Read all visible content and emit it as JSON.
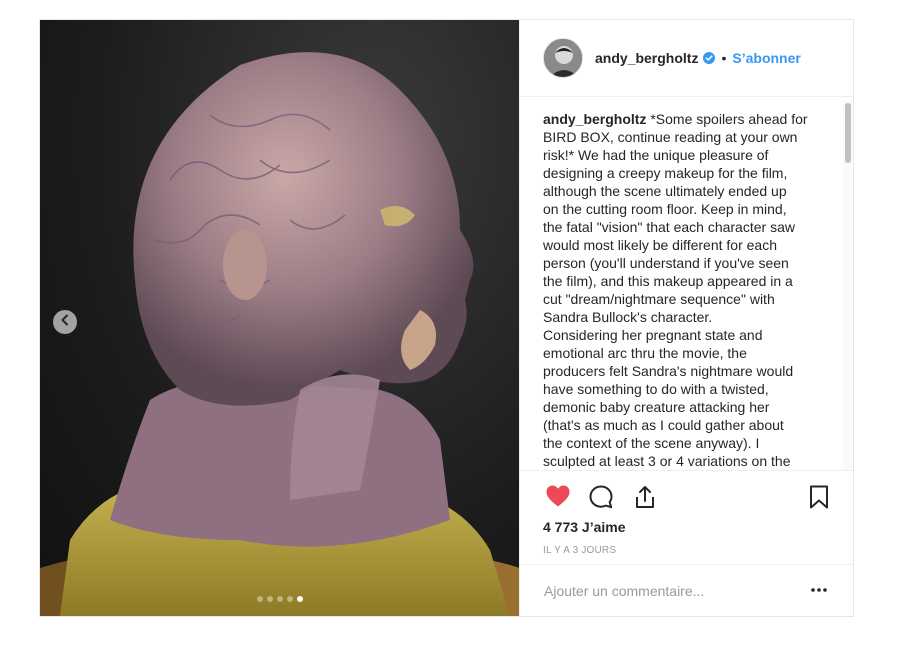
{
  "post": {
    "username": "andy_bergholtz",
    "separator": "•",
    "follow_label": "S’abonner",
    "caption_username": "andy_bergholtz",
    "caption_text": " *Some spoilers ahead for\nBIRD BOX, continue reading at your own\nrisk!* We had the unique pleasure of\ndesigning a creepy makeup for the film,\nalthough the scene ultimately ended up\non the cutting room floor. Keep in mind,\nthe fatal \"vision\" that each character saw\nwould most likely be different for each\nperson (you'll understand if you've seen\nthe film), and this makeup appeared in a\ncut \"dream/nightmare sequence\" with\nSandra Bullock's character.\nConsidering her pregnant state and\nemotional arc thru the movie, the\nproducers felt Sandra's nightmare would\nhave something to do with a twisted,\ndemonic baby creature attacking her\n(that's as much as I could gather about\nthe context of the scene anyway). I\nsculpted at least 3 or 4 variations on the",
    "likes": "4 773 J’aime",
    "time": "IL Y A 3 JOURS",
    "comment_placeholder": "Ajouter un commentaire...",
    "carousel": {
      "count": 5,
      "active_index": 4
    }
  },
  "colors": {
    "accent": "#3897f0",
    "like_red": "#ed4956",
    "border": "#efefef"
  },
  "icons": {
    "prev": "chevron-left-icon",
    "verified": "verified-badge-icon",
    "like": "heart-filled-icon",
    "comment": "comment-bubble-icon",
    "share": "share-icon",
    "save": "bookmark-icon",
    "more": "more-horizontal-icon"
  }
}
